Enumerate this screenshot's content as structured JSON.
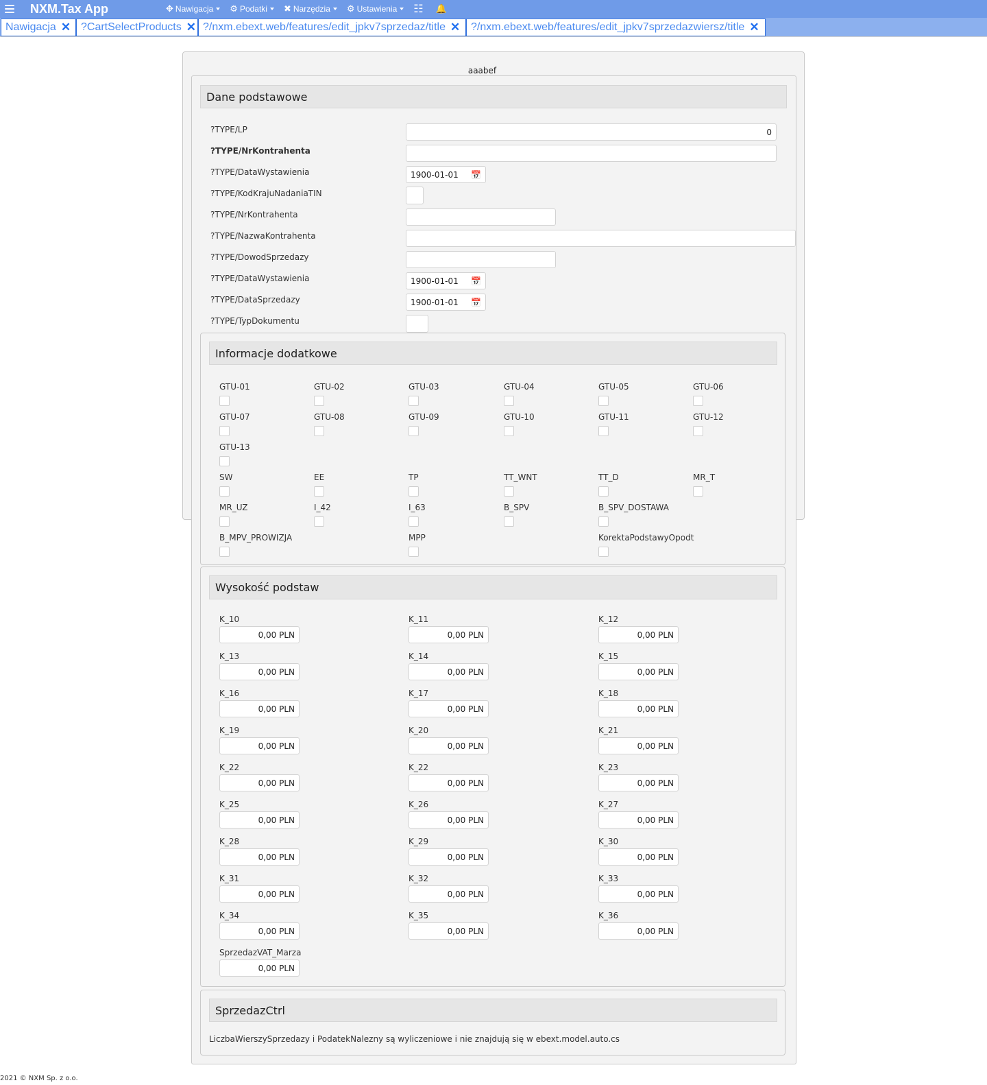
{
  "navbar": {
    "brand": "NXM.Tax App",
    "menu": [
      {
        "icon": "move-icon",
        "glyph": "✥",
        "label": "Nawigacja"
      },
      {
        "icon": "gears-icon",
        "glyph": "⚙",
        "label": "Podatki"
      },
      {
        "icon": "tools-icon",
        "glyph": "✖",
        "label": "Narzędzia"
      },
      {
        "icon": "gears-icon",
        "glyph": "⚙",
        "label": "Ustawienia"
      }
    ],
    "tasks_icon": "☷",
    "bell_icon": "🔔"
  },
  "tabs": [
    {
      "label": "Nawigacja"
    },
    {
      "label": "?CartSelectProducts"
    },
    {
      "label": "?/nxm.ebext.web/features/edit_jpkv7sprzedaz/title"
    },
    {
      "label": "?/nxm.ebext.web/features/edit_jpkv7sprzedazwiersz/title"
    }
  ],
  "form": {
    "title": "aaabef",
    "sections": {
      "basic": "Dane podstawowe",
      "extra": "Informacje dodatkowe",
      "bases": "Wysokość podstaw",
      "ctrl": "SprzedazCtrl"
    },
    "basic_fields": [
      {
        "label": "?TYPE/LP",
        "value": "0"
      },
      {
        "label": "?TYPE/NrKontrahenta",
        "value": ""
      },
      {
        "label": "?TYPE/DataWystawienia",
        "value": "1900-01-01"
      },
      {
        "label": "?TYPE/KodKrajuNadaniaTIN",
        "value": ""
      },
      {
        "label": "?TYPE/NrKontrahenta",
        "value": ""
      },
      {
        "label": "?TYPE/NazwaKontrahenta",
        "value": ""
      },
      {
        "label": "?TYPE/DowodSprzedazy",
        "value": ""
      },
      {
        "label": "?TYPE/DataWystawienia",
        "value": "1900-01-01"
      },
      {
        "label": "?TYPE/DataSprzedazy",
        "value": "1900-01-01"
      },
      {
        "label": "?TYPE/TypDokumentu",
        "value": ""
      }
    ],
    "calendar_glyph": "📅",
    "checkboxes": [
      "GTU-01",
      "GTU-02",
      "GTU-03",
      "GTU-04",
      "GTU-05",
      "GTU-06",
      "GTU-07",
      "GTU-08",
      "GTU-09",
      "GTU-10",
      "GTU-11",
      "GTU-12",
      "GTU-13",
      "SW",
      "EE",
      "TP",
      "TT_WNT",
      "TT_D",
      "MR_T",
      "MR_UZ",
      "I_42",
      "I_63",
      "B_SPV",
      "B_SPV_DOSTAWA",
      "B_MPV_PROWIZJA",
      "MPP",
      "KorektaPodstawyOpodt"
    ],
    "amounts": [
      {
        "label": "K_10",
        "value": "0,00 PLN"
      },
      {
        "label": "K_11",
        "value": "0,00 PLN"
      },
      {
        "label": "K_12",
        "value": "0,00 PLN"
      },
      {
        "label": "K_13",
        "value": "0,00 PLN"
      },
      {
        "label": "K_14",
        "value": "0,00 PLN"
      },
      {
        "label": "K_15",
        "value": "0,00 PLN"
      },
      {
        "label": "K_16",
        "value": "0,00 PLN"
      },
      {
        "label": "K_17",
        "value": "0,00 PLN"
      },
      {
        "label": "K_18",
        "value": "0,00 PLN"
      },
      {
        "label": "K_19",
        "value": "0,00 PLN"
      },
      {
        "label": "K_20",
        "value": "0,00 PLN"
      },
      {
        "label": "K_21",
        "value": "0,00 PLN"
      },
      {
        "label": "K_22",
        "value": "0,00 PLN"
      },
      {
        "label": "K_22",
        "value": "0,00 PLN"
      },
      {
        "label": "K_23",
        "value": "0,00 PLN"
      },
      {
        "label": "K_25",
        "value": "0,00 PLN"
      },
      {
        "label": "K_26",
        "value": "0,00 PLN"
      },
      {
        "label": "K_27",
        "value": "0,00 PLN"
      },
      {
        "label": "K_28",
        "value": "0,00 PLN"
      },
      {
        "label": "K_29",
        "value": "0,00 PLN"
      },
      {
        "label": "K_30",
        "value": "0,00 PLN"
      },
      {
        "label": "K_31",
        "value": "0,00 PLN"
      },
      {
        "label": "K_32",
        "value": "0,00 PLN"
      },
      {
        "label": "K_33",
        "value": "0,00 PLN"
      },
      {
        "label": "K_34",
        "value": "0,00 PLN"
      },
      {
        "label": "K_35",
        "value": "0,00 PLN"
      },
      {
        "label": "K_36",
        "value": "0,00 PLN"
      },
      {
        "label": "SprzedazVAT_Marza",
        "value": "0,00 PLN"
      }
    ],
    "ctrl_note": "LiczbaWierszySprzedazy i PodatekNalezny są wyliczeniowe i nie znajdują się w ebext.model.auto.cs"
  },
  "footer": "2021 © NXM Sp. z o.o."
}
